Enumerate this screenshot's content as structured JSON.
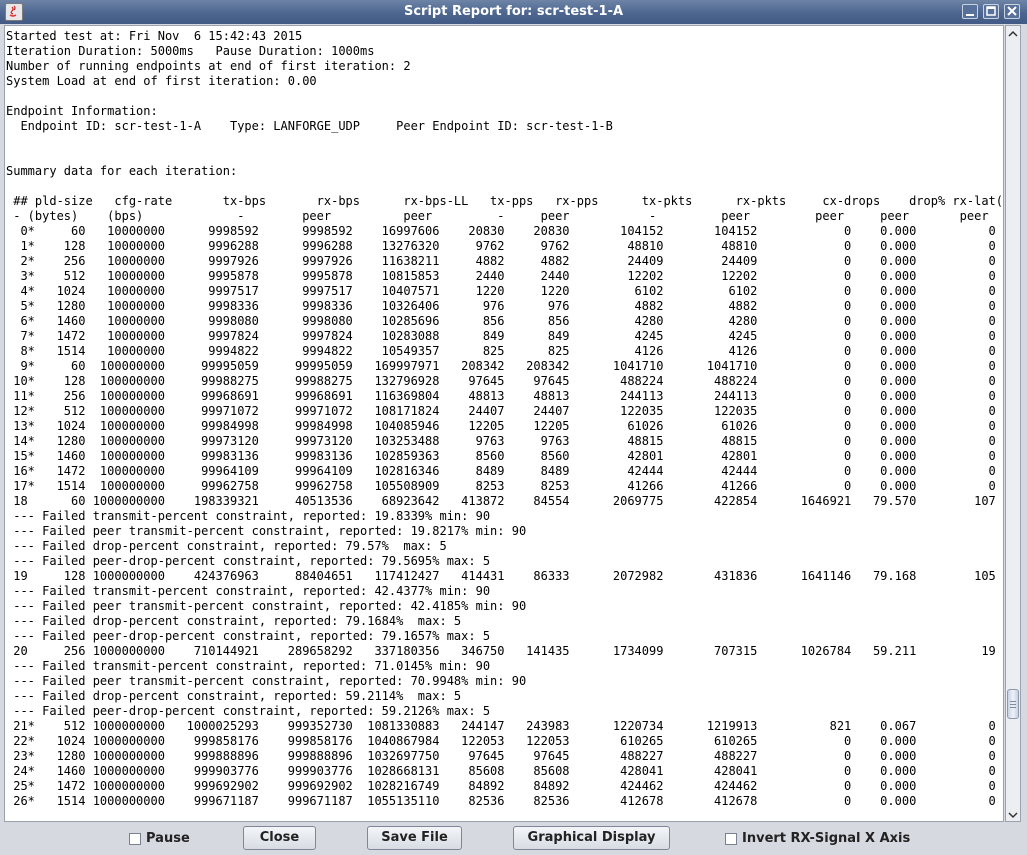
{
  "window": {
    "title": "Script Report for: scr-test-1-A"
  },
  "report": {
    "text": "Started test at: Fri Nov  6 15:42:43 2015\nIteration Duration: 5000ms   Pause Duration: 1000ms\nNumber of running endpoints at end of first iteration: 2\nSystem Load at end of first iteration: 0.00\n\nEndpoint Information:\n  Endpoint ID: scr-test-1-A    Type: LANFORGE_UDP     Peer Endpoint ID: scr-test-1-B\n\n\nSummary data for each iteration:\n\n ## pld-size   cfg-rate       tx-bps       rx-bps      rx-bps-LL   tx-pps   rx-pps      tx-pkts      rx-pkts     cx-drops    drop% rx-lat(ms)\n - (bytes)    (bps)             -        peer          peer         -     peer           -         peer         peer     peer       peer\n  0*     60   10000000      9998592      9998592    16997606    20830    20830       104152       104152            0    0.000          0\n  1*    128   10000000      9996288      9996288    13276320     9762     9762        48810        48810            0    0.000          0\n  2*    256   10000000      9997926      9997926    11638211     4882     4882        24409        24409            0    0.000          0\n  3*    512   10000000      9995878      9995878    10815853     2440     2440        12202        12202            0    0.000          0\n  4*   1024   10000000      9997517      9997517    10407571     1220     1220         6102         6102            0    0.000          0\n  5*   1280   10000000      9998336      9998336    10326406      976      976         4882         4882            0    0.000          0\n  6*   1460   10000000      9998080      9998080    10285696      856      856         4280         4280            0    0.000          0\n  7*   1472   10000000      9997824      9997824    10283088      849      849         4245         4245            0    0.000          0\n  8*   1514   10000000      9994822      9994822    10549357      825      825         4126         4126            0    0.000          0\n  9*     60  100000000     99995059     99995059   169997971   208342   208342      1041710      1041710            0    0.000          0\n 10*    128  100000000     99988275     99988275   132796928    97645    97645       488224       488224            0    0.000          0\n 11*    256  100000000     99968691     99968691   116369804    48813    48813       244113       244113            0    0.000          0\n 12*    512  100000000     99971072     99971072   108171824    24407    24407       122035       122035            0    0.000          0\n 13*   1024  100000000     99984998     99984998   104085946    12205    12205        61026        61026            0    0.000          0\n 14*   1280  100000000     99973120     99973120   103253488     9763     9763        48815        48815            0    0.000          0\n 15*   1460  100000000     99983136     99983136   102859363     8560     8560        42801        42801            0    0.000          0\n 16*   1472  100000000     99964109     99964109   102816346     8489     8489        42444        42444            0    0.000          0\n 17*   1514  100000000     99962758     99962758   105508909     8253     8253        41266        41266            0    0.000          0\n 18      60 1000000000    198339321     40513536    68923642   413872    84554      2069775       422854      1646921   79.570        107\n --- Failed transmit-percent constraint, reported: 19.8339% min: 90\n --- Failed peer transmit-percent constraint, reported: 19.8217% min: 90\n --- Failed drop-percent constraint, reported: 79.57%  max: 5\n --- Failed peer-drop-percent constraint, reported: 79.5695% max: 5\n 19     128 1000000000    424376963     88404651   117412427   414431    86333      2072982       431836      1641146   79.168        105\n --- Failed transmit-percent constraint, reported: 42.4377% min: 90\n --- Failed peer transmit-percent constraint, reported: 42.4185% min: 90\n --- Failed drop-percent constraint, reported: 79.1684%  max: 5\n --- Failed peer-drop-percent constraint, reported: 79.1657% max: 5\n 20     256 1000000000    710144921    289658292   337180356   346750   141435      1734099       707315      1026784   59.211         19\n --- Failed transmit-percent constraint, reported: 71.0145% min: 90\n --- Failed peer transmit-percent constraint, reported: 70.9948% min: 90\n --- Failed drop-percent constraint, reported: 59.2114%  max: 5\n --- Failed peer-drop-percent constraint, reported: 59.2126% max: 5\n 21*    512 1000000000   1000025293    999352730  1081330883   244147   243983      1220734      1219913          821    0.067          0\n 22*   1024 1000000000    999858176    999858176  1040867984   122053   122053       610265       610265            0    0.000          0\n 23*   1280 1000000000    999888896    999888896  1032697750    97645    97645       488227       488227            0    0.000          0\n 24*   1460 1000000000    999903776    999903776  1028668131    85608    85608       428041       428041            0    0.000          0\n 25*   1472 1000000000    999692902    999692902  1028216749    84892    84892       424462       424462            0    0.000          0\n 26*   1514 1000000000    999671187    999671187  1055135110    82536    82536       412678       412678            0    0.000          0"
  },
  "buttons": {
    "pause": "Pause",
    "close": "Close",
    "save_file": "Save File",
    "graphical_display": "Graphical Display",
    "invert_rx_signal": "Invert RX-Signal X Axis"
  },
  "scroll_position": 0.88,
  "colors": {
    "titlebar": "#4d6690",
    "background": "#d6d9df"
  }
}
